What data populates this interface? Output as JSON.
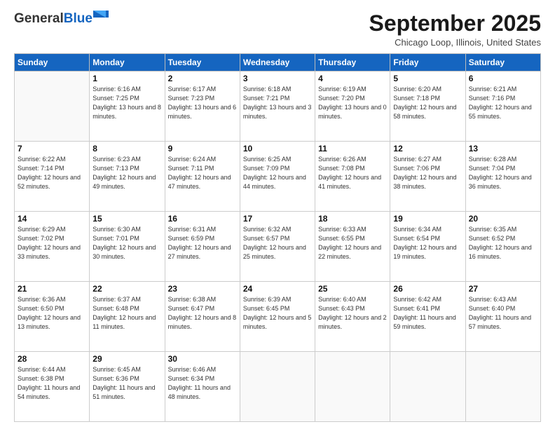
{
  "header": {
    "logo_general": "General",
    "logo_blue": "Blue",
    "month": "September 2025",
    "location": "Chicago Loop, Illinois, United States"
  },
  "weekdays": [
    "Sunday",
    "Monday",
    "Tuesday",
    "Wednesday",
    "Thursday",
    "Friday",
    "Saturday"
  ],
  "weeks": [
    [
      {
        "day": "",
        "sunrise": "",
        "sunset": "",
        "daylight": ""
      },
      {
        "day": "1",
        "sunrise": "Sunrise: 6:16 AM",
        "sunset": "Sunset: 7:25 PM",
        "daylight": "Daylight: 13 hours and 8 minutes."
      },
      {
        "day": "2",
        "sunrise": "Sunrise: 6:17 AM",
        "sunset": "Sunset: 7:23 PM",
        "daylight": "Daylight: 13 hours and 6 minutes."
      },
      {
        "day": "3",
        "sunrise": "Sunrise: 6:18 AM",
        "sunset": "Sunset: 7:21 PM",
        "daylight": "Daylight: 13 hours and 3 minutes."
      },
      {
        "day": "4",
        "sunrise": "Sunrise: 6:19 AM",
        "sunset": "Sunset: 7:20 PM",
        "daylight": "Daylight: 13 hours and 0 minutes."
      },
      {
        "day": "5",
        "sunrise": "Sunrise: 6:20 AM",
        "sunset": "Sunset: 7:18 PM",
        "daylight": "Daylight: 12 hours and 58 minutes."
      },
      {
        "day": "6",
        "sunrise": "Sunrise: 6:21 AM",
        "sunset": "Sunset: 7:16 PM",
        "daylight": "Daylight: 12 hours and 55 minutes."
      }
    ],
    [
      {
        "day": "7",
        "sunrise": "Sunrise: 6:22 AM",
        "sunset": "Sunset: 7:14 PM",
        "daylight": "Daylight: 12 hours and 52 minutes."
      },
      {
        "day": "8",
        "sunrise": "Sunrise: 6:23 AM",
        "sunset": "Sunset: 7:13 PM",
        "daylight": "Daylight: 12 hours and 49 minutes."
      },
      {
        "day": "9",
        "sunrise": "Sunrise: 6:24 AM",
        "sunset": "Sunset: 7:11 PM",
        "daylight": "Daylight: 12 hours and 47 minutes."
      },
      {
        "day": "10",
        "sunrise": "Sunrise: 6:25 AM",
        "sunset": "Sunset: 7:09 PM",
        "daylight": "Daylight: 12 hours and 44 minutes."
      },
      {
        "day": "11",
        "sunrise": "Sunrise: 6:26 AM",
        "sunset": "Sunset: 7:08 PM",
        "daylight": "Daylight: 12 hours and 41 minutes."
      },
      {
        "day": "12",
        "sunrise": "Sunrise: 6:27 AM",
        "sunset": "Sunset: 7:06 PM",
        "daylight": "Daylight: 12 hours and 38 minutes."
      },
      {
        "day": "13",
        "sunrise": "Sunrise: 6:28 AM",
        "sunset": "Sunset: 7:04 PM",
        "daylight": "Daylight: 12 hours and 36 minutes."
      }
    ],
    [
      {
        "day": "14",
        "sunrise": "Sunrise: 6:29 AM",
        "sunset": "Sunset: 7:02 PM",
        "daylight": "Daylight: 12 hours and 33 minutes."
      },
      {
        "day": "15",
        "sunrise": "Sunrise: 6:30 AM",
        "sunset": "Sunset: 7:01 PM",
        "daylight": "Daylight: 12 hours and 30 minutes."
      },
      {
        "day": "16",
        "sunrise": "Sunrise: 6:31 AM",
        "sunset": "Sunset: 6:59 PM",
        "daylight": "Daylight: 12 hours and 27 minutes."
      },
      {
        "day": "17",
        "sunrise": "Sunrise: 6:32 AM",
        "sunset": "Sunset: 6:57 PM",
        "daylight": "Daylight: 12 hours and 25 minutes."
      },
      {
        "day": "18",
        "sunrise": "Sunrise: 6:33 AM",
        "sunset": "Sunset: 6:55 PM",
        "daylight": "Daylight: 12 hours and 22 minutes."
      },
      {
        "day": "19",
        "sunrise": "Sunrise: 6:34 AM",
        "sunset": "Sunset: 6:54 PM",
        "daylight": "Daylight: 12 hours and 19 minutes."
      },
      {
        "day": "20",
        "sunrise": "Sunrise: 6:35 AM",
        "sunset": "Sunset: 6:52 PM",
        "daylight": "Daylight: 12 hours and 16 minutes."
      }
    ],
    [
      {
        "day": "21",
        "sunrise": "Sunrise: 6:36 AM",
        "sunset": "Sunset: 6:50 PM",
        "daylight": "Daylight: 12 hours and 13 minutes."
      },
      {
        "day": "22",
        "sunrise": "Sunrise: 6:37 AM",
        "sunset": "Sunset: 6:48 PM",
        "daylight": "Daylight: 12 hours and 11 minutes."
      },
      {
        "day": "23",
        "sunrise": "Sunrise: 6:38 AM",
        "sunset": "Sunset: 6:47 PM",
        "daylight": "Daylight: 12 hours and 8 minutes."
      },
      {
        "day": "24",
        "sunrise": "Sunrise: 6:39 AM",
        "sunset": "Sunset: 6:45 PM",
        "daylight": "Daylight: 12 hours and 5 minutes."
      },
      {
        "day": "25",
        "sunrise": "Sunrise: 6:40 AM",
        "sunset": "Sunset: 6:43 PM",
        "daylight": "Daylight: 12 hours and 2 minutes."
      },
      {
        "day": "26",
        "sunrise": "Sunrise: 6:42 AM",
        "sunset": "Sunset: 6:41 PM",
        "daylight": "Daylight: 11 hours and 59 minutes."
      },
      {
        "day": "27",
        "sunrise": "Sunrise: 6:43 AM",
        "sunset": "Sunset: 6:40 PM",
        "daylight": "Daylight: 11 hours and 57 minutes."
      }
    ],
    [
      {
        "day": "28",
        "sunrise": "Sunrise: 6:44 AM",
        "sunset": "Sunset: 6:38 PM",
        "daylight": "Daylight: 11 hours and 54 minutes."
      },
      {
        "day": "29",
        "sunrise": "Sunrise: 6:45 AM",
        "sunset": "Sunset: 6:36 PM",
        "daylight": "Daylight: 11 hours and 51 minutes."
      },
      {
        "day": "30",
        "sunrise": "Sunrise: 6:46 AM",
        "sunset": "Sunset: 6:34 PM",
        "daylight": "Daylight: 11 hours and 48 minutes."
      },
      {
        "day": "",
        "sunrise": "",
        "sunset": "",
        "daylight": ""
      },
      {
        "day": "",
        "sunrise": "",
        "sunset": "",
        "daylight": ""
      },
      {
        "day": "",
        "sunrise": "",
        "sunset": "",
        "daylight": ""
      },
      {
        "day": "",
        "sunrise": "",
        "sunset": "",
        "daylight": ""
      }
    ]
  ]
}
